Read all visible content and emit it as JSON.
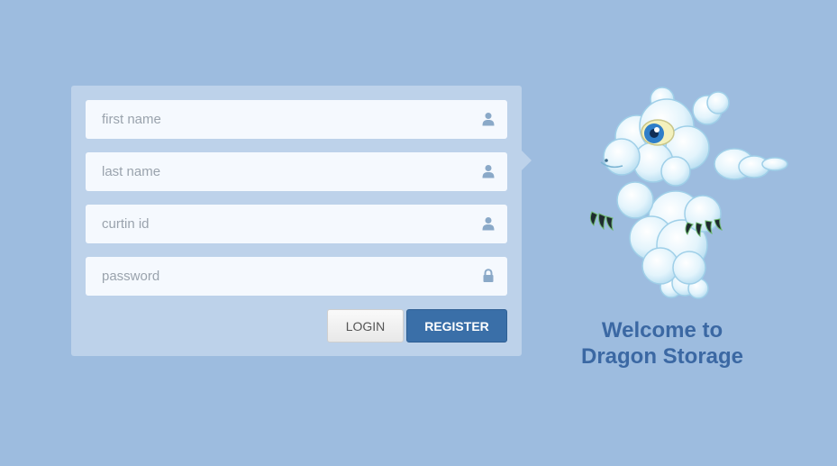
{
  "form": {
    "first_name": {
      "placeholder": "first name",
      "value": "",
      "icon": "user-icon"
    },
    "last_name": {
      "placeholder": "last name",
      "value": "",
      "icon": "user-icon"
    },
    "curtin_id": {
      "placeholder": "curtin id",
      "value": "",
      "icon": "user-icon"
    },
    "password": {
      "placeholder": "password",
      "value": "",
      "icon": "lock-icon"
    },
    "login_label": "LOGIN",
    "register_label": "REGISTER"
  },
  "welcome": {
    "line1": "Welcome to",
    "line2": "Dragon Storage"
  },
  "colors": {
    "background": "#9dbcdf",
    "panel": "#bdd2ea",
    "accent": "#3a6fa8",
    "heading": "#3b68a3"
  }
}
